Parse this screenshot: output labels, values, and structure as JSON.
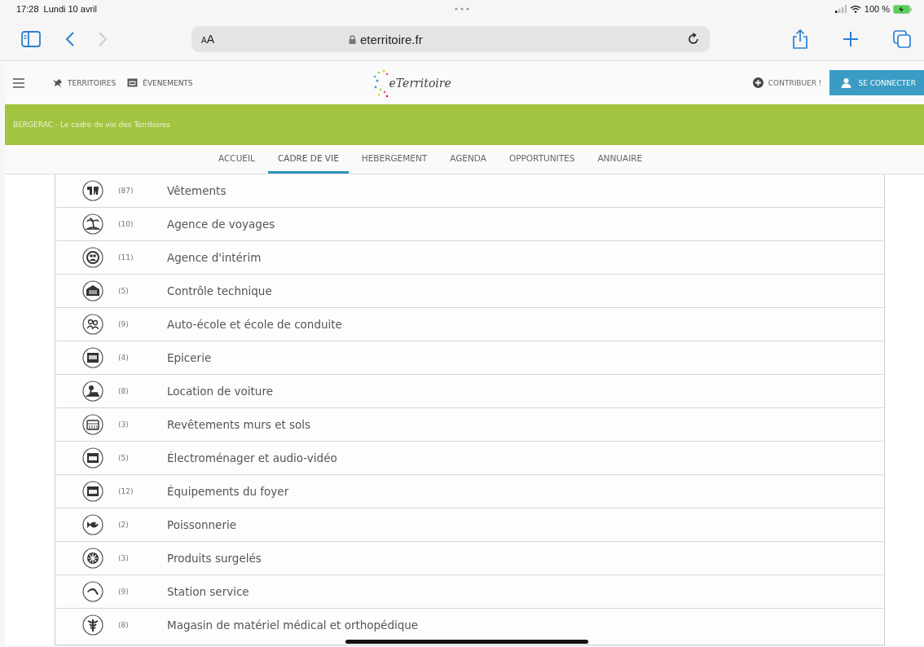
{
  "status_bar": {
    "time": "17:28",
    "date": "Lundi 10 avril",
    "battery": "100 %"
  },
  "browser": {
    "text_size_button": "AA",
    "url": "eterritoire.fr"
  },
  "site_header": {
    "nav_links": [
      "TERRITOIRES",
      "ÉVENEMENTS"
    ],
    "logo": "eTerritoire",
    "contribute": "CONTRIBUER !",
    "login": "SE CONNECTER"
  },
  "banner": {
    "text": "BERGERAC - Le cadre de vie des Territoires"
  },
  "tabs": [
    {
      "label": "ACCUEIL",
      "selected": false
    },
    {
      "label": "CADRE DE VIE",
      "selected": true
    },
    {
      "label": "HEBERGEMENT",
      "selected": false
    },
    {
      "label": "AGENDA",
      "selected": false
    },
    {
      "label": "OPPORTUNITES",
      "selected": false
    },
    {
      "label": "ANNUAIRE",
      "selected": false
    }
  ],
  "categories": [
    {
      "count": "(87)",
      "name": "Vêtements"
    },
    {
      "count": "(10)",
      "name": "Agence de voyages"
    },
    {
      "count": "(11)",
      "name": "Agence d'intérim"
    },
    {
      "count": "(5)",
      "name": "Contrôle technique"
    },
    {
      "count": "(9)",
      "name": "Auto-école et école de conduite"
    },
    {
      "count": "(4)",
      "name": "Epicerie"
    },
    {
      "count": "(8)",
      "name": "Location de voiture"
    },
    {
      "count": "(3)",
      "name": "Revêtements murs et sols"
    },
    {
      "count": "(5)",
      "name": "Électroménager et audio-vidéo"
    },
    {
      "count": "(12)",
      "name": "Équipements du foyer"
    },
    {
      "count": "(2)",
      "name": "Poissonnerie"
    },
    {
      "count": "(3)",
      "name": "Produits surgelés"
    },
    {
      "count": "(9)",
      "name": "Station service"
    },
    {
      "count": "(8)",
      "name": "Magasin de matériel médical et orthopédique"
    }
  ]
}
